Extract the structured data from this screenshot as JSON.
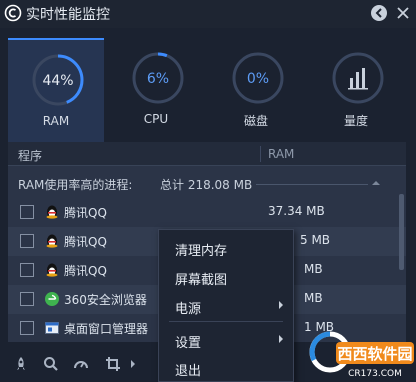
{
  "window": {
    "title": "实时性能监控",
    "back_icon": "back-arrow-icon",
    "close_icon": "close-icon"
  },
  "tiles": [
    {
      "label": "RAM",
      "value": "44%",
      "progress": 0.44,
      "active": true
    },
    {
      "label": "CPU",
      "value": "6%",
      "progress": 0.06,
      "active": false
    },
    {
      "label": "磁盘",
      "value": "0%",
      "progress": 0.0,
      "active": false
    },
    {
      "label": "量度",
      "icon": "bar-chart-icon",
      "active": false
    }
  ],
  "table": {
    "columns": {
      "name": "程序",
      "memory": "RAM"
    },
    "summary_label": "RAM使用率高的进程:",
    "summary_total": "总计 218.08 MB",
    "rows": [
      {
        "name": "腾讯QQ",
        "memory": "37.34 MB",
        "icon": "qq-penguin-icon"
      },
      {
        "name": "腾讯QQ",
        "memory": "5 MB",
        "icon": "qq-penguin-icon"
      },
      {
        "name": "腾讯QQ",
        "memory": "MB",
        "icon": "qq-penguin-icon"
      },
      {
        "name": "360安全浏览器",
        "memory": "MB",
        "icon": "browser-360-icon"
      },
      {
        "name": "桌面窗口管理器",
        "memory": "1 MB",
        "icon": "window-manager-icon"
      }
    ]
  },
  "context_menu": {
    "items": [
      {
        "label": "清理内存",
        "submenu": false
      },
      {
        "label": "屏幕截图",
        "submenu": false
      },
      {
        "label": "电源",
        "submenu": true
      },
      {
        "label": "设置",
        "submenu": true
      },
      {
        "label": "退出",
        "submenu": false
      }
    ]
  },
  "toolbar": {
    "icons": [
      "rocket-icon",
      "search-icon",
      "speedometer-icon",
      "crop-icon",
      "chevron-right-icon"
    ]
  },
  "watermark": {
    "brand": "西西软件园",
    "domain": "CR173.COM"
  },
  "colors": {
    "background": "#1b2230",
    "panel": "#2b3447",
    "accent": "#3d8bfd",
    "text": "#dce3ec"
  }
}
